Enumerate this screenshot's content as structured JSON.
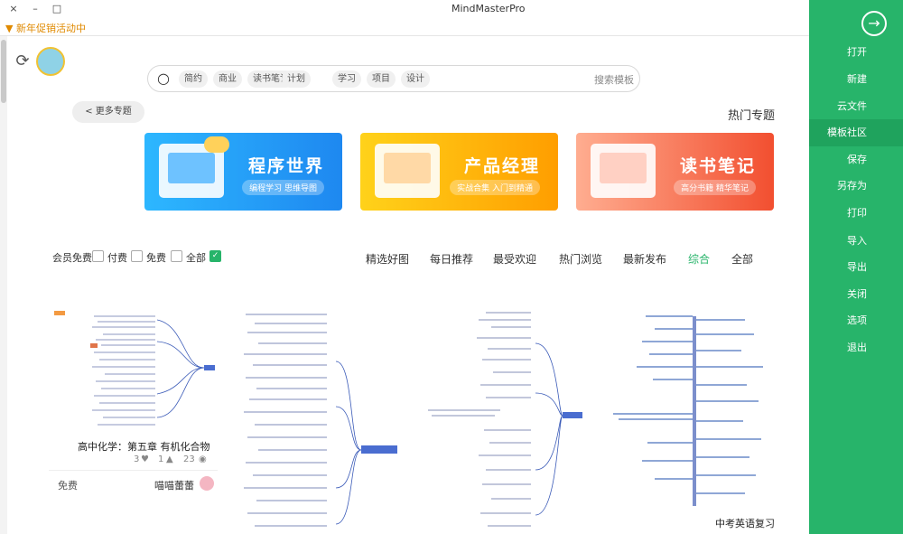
{
  "window": {
    "title": "MindMasterPro",
    "buttons": [
      "×",
      "–",
      "□"
    ]
  },
  "promo": "▼ 新年促销活动中",
  "search": {
    "placeholder": "搜索模板",
    "chips": [
      "简约",
      "商业",
      "读书笔记",
      "计划",
      "学习",
      "项目",
      "设计"
    ]
  },
  "more_topics": "< 更多专题",
  "section_title": "热门专题",
  "banners": [
    {
      "title": "程序世界",
      "subtitle": "编程学习 思维导图",
      "color": "#1e9ef4"
    },
    {
      "title": "产品经理",
      "subtitle": "实战合集 入门到精通",
      "color": "#ffb400"
    },
    {
      "title": "读书笔记",
      "subtitle": "高分书籍 精华笔记",
      "color": "#f56a45"
    }
  ],
  "tabs": [
    "全部",
    "综合",
    "最新发布",
    "热门浏览",
    "最受欢迎",
    "每日推荐",
    "精选好图"
  ],
  "active_tab": "综合",
  "filters": [
    {
      "label": "全部",
      "checked": true
    },
    {
      "label": "免费",
      "checked": false
    },
    {
      "label": "付费",
      "checked": false
    },
    {
      "label": "会员免费",
      "checked": false
    }
  ],
  "cards": [
    {
      "title": "高中化学：第五章 有机化合物",
      "views": "23",
      "likes": "1",
      "favorites": "3",
      "price": "免费",
      "author": "喵喵蕾蕾"
    },
    {
      "title": "中考英语复习",
      "views": "",
      "likes": "",
      "favorites": "",
      "price": "",
      "author": ""
    }
  ],
  "sidebar": {
    "back_icon": "arrow-right-circle-icon",
    "items": [
      "打开",
      "新建",
      "云文件",
      "模板社区",
      "保存",
      "另存为",
      "打印",
      "导入",
      "导出",
      "关闭",
      "选项",
      "退出"
    ],
    "active": "模板社区"
  },
  "colors": {
    "accent": "#27b46a",
    "promo": "#e08a00"
  }
}
